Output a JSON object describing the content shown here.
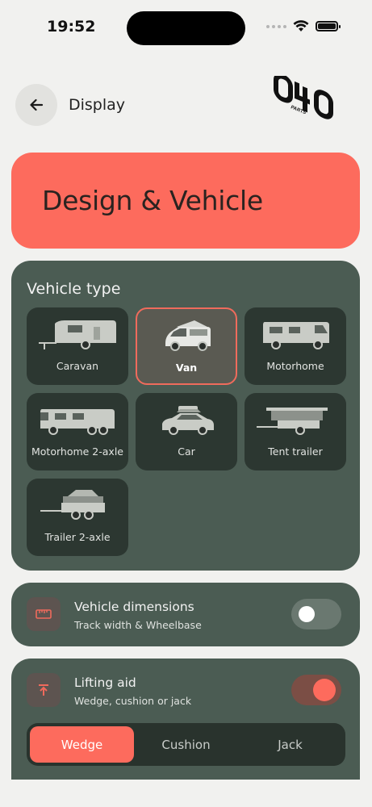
{
  "status": {
    "time": "19:52"
  },
  "header": {
    "title": "Display",
    "back_icon": "arrow-left-icon",
    "logo_text": "040",
    "logo_small": "PARTS"
  },
  "hero": {
    "title": "Design & Vehicle"
  },
  "vehicle_type": {
    "heading": "Vehicle type",
    "selected": "Van",
    "options": [
      {
        "label": "Caravan",
        "icon": "caravan-icon"
      },
      {
        "label": "Van",
        "icon": "van-icon"
      },
      {
        "label": "Motorhome",
        "icon": "motorhome-icon"
      },
      {
        "label": "Motorhome 2-axle",
        "icon": "motorhome-2-axle-icon"
      },
      {
        "label": "Car",
        "icon": "car-icon"
      },
      {
        "label": "Tent trailer",
        "icon": "tent-trailer-icon"
      },
      {
        "label": "Trailer 2-axle",
        "icon": "trailer-2-axle-icon"
      }
    ]
  },
  "dimensions": {
    "title": "Vehicle dimensions",
    "subtitle": "Track width & Wheelbase",
    "enabled": false,
    "icon": "ruler-icon"
  },
  "lifting": {
    "title": "Lifting aid",
    "subtitle": "Wedge, cushion or jack",
    "enabled": true,
    "icon": "lift-up-icon",
    "options": [
      "Wedge",
      "Cushion",
      "Jack"
    ],
    "selected": "Wedge"
  },
  "colors": {
    "accent": "#fd6b5d",
    "card": "#4b5c53",
    "tile": "#2c3731",
    "background": "#f1f1ef"
  }
}
